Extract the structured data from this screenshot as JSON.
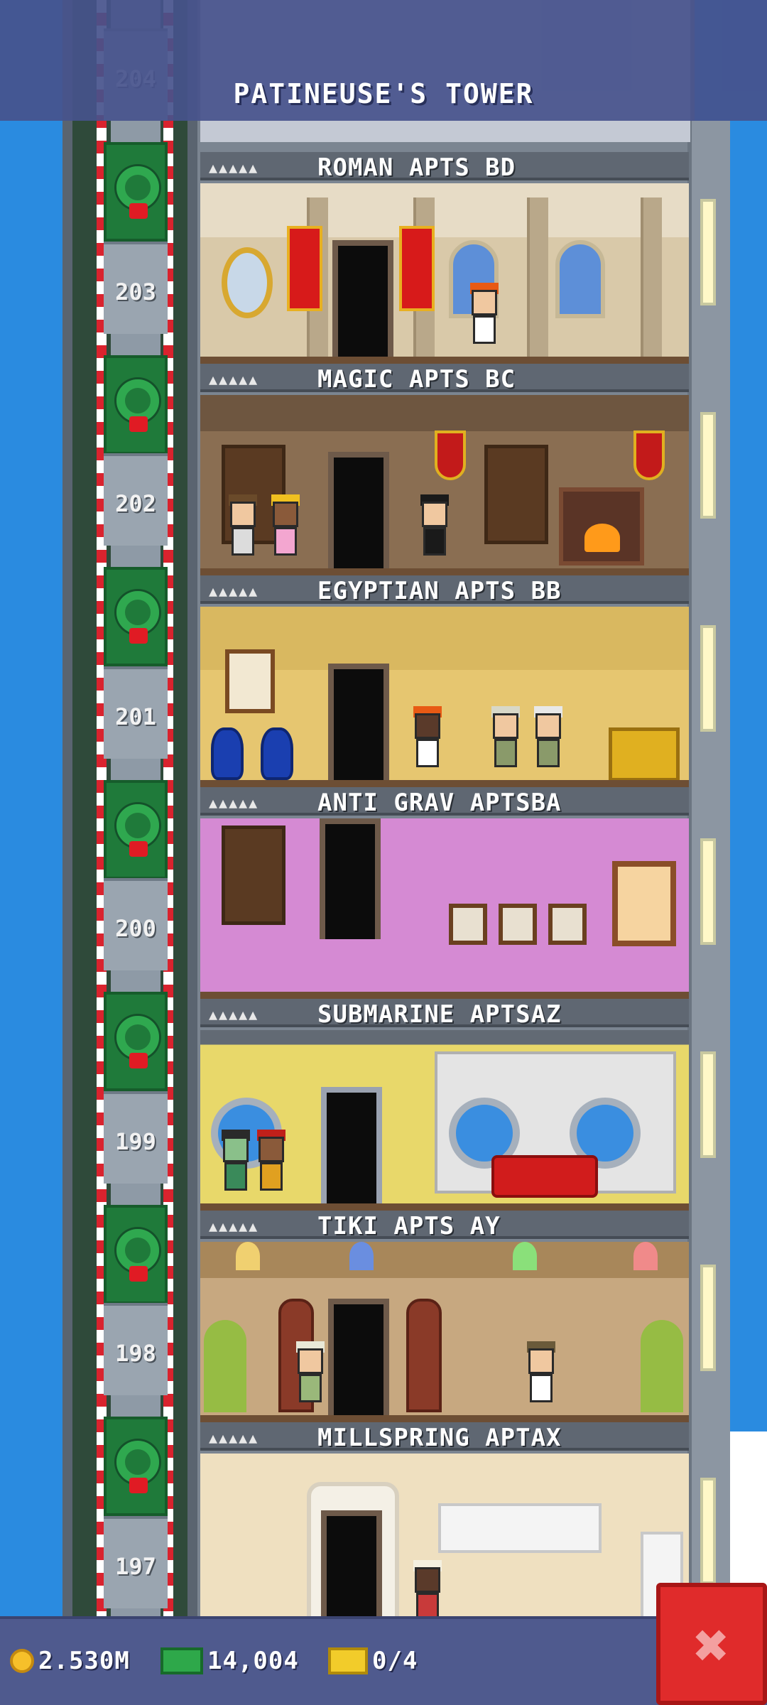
{
  "header": {
    "title": "PATINEUSE'S TOWER"
  },
  "floors": [
    {
      "number": "204",
      "name": ""
    },
    {
      "number": "203",
      "name": "ROMAN APTS BD",
      "pips": "▲▲▲▲▲"
    },
    {
      "number": "202",
      "name": "MAGIC APTS BC",
      "pips": "▲▲▲▲▲"
    },
    {
      "number": "201",
      "name": "EGYPTIAN APTS BB",
      "pips": "▲▲▲▲▲"
    },
    {
      "number": "200",
      "name": "ANTI GRAV APTSBA",
      "pips": "▲▲▲▲▲"
    },
    {
      "number": "199",
      "name": "SUBMARINE APTSAZ",
      "pips": "▲▲▲▲▲"
    },
    {
      "number": "198",
      "name": "TIKI APTS AY",
      "pips": "▲▲▲▲▲"
    },
    {
      "number": "197",
      "name": "MILLSPRING APTAX",
      "pips": "▲▲▲▲▲"
    }
  ],
  "status": {
    "coins": "2.530M",
    "bux": "14,004",
    "tickets": "0/4"
  },
  "icons": {
    "coin": "coin-icon",
    "bux": "bux-icon",
    "ticket": "ticket-icon",
    "close": "close-icon",
    "wreath": "wreath-icon"
  },
  "colors": {
    "sky": "#2a8be0",
    "bar": "#4f5a8e",
    "close": "#e02b2b",
    "wreath": "#2fa84f"
  },
  "close_label": "✖"
}
